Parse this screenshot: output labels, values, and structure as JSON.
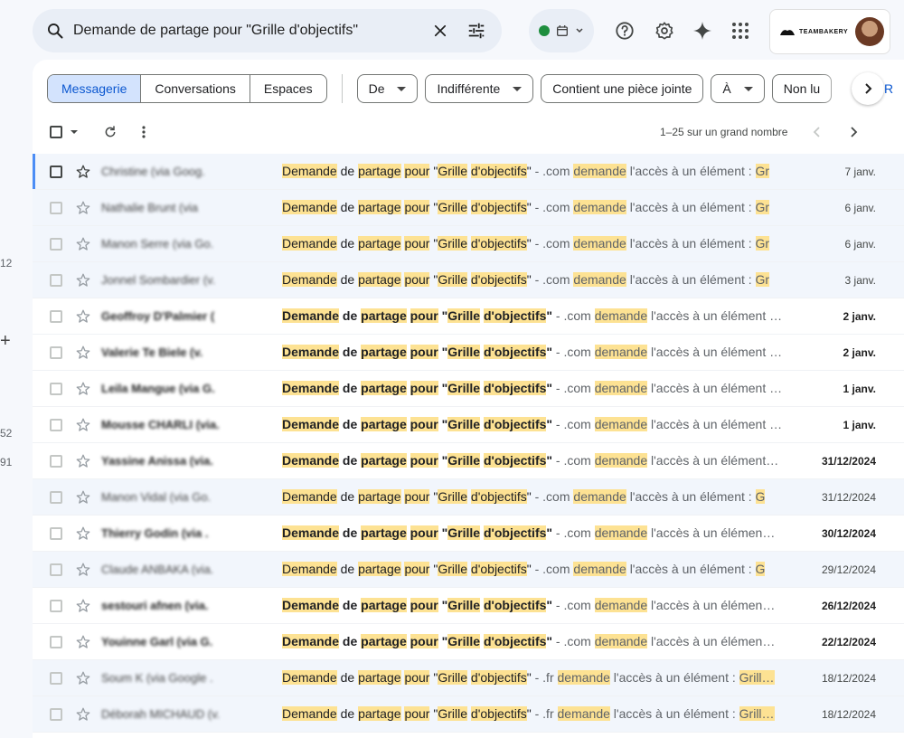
{
  "left_edge": {
    "frag1": "12",
    "frag2": "52",
    "frag3": "91"
  },
  "search": {
    "query": "Demande de partage pour \"Grille d'objectifs\"",
    "icon": "search-icon",
    "clear_icon": "close-icon",
    "options_icon": "tune-icon"
  },
  "top_bar": {
    "status_color": "#1e8e3e",
    "help_icon": "help-icon",
    "settings_icon": "gear-icon",
    "gemini_icon": "sparkle-icon",
    "apps_icon": "apps-grid-icon",
    "account_logo_text": "TEAMBAKERY"
  },
  "filters": {
    "tabs": [
      "Messagerie",
      "Conversations",
      "Espaces"
    ],
    "chips": [
      "De",
      "Indifférente",
      "Contient une pièce jointe",
      "À",
      "Non lu"
    ],
    "trailing_fragment": "R"
  },
  "toolbar": {
    "pager_text": "1–25 sur un grand nombre"
  },
  "messages": [
    {
      "sender": "Christine (via Goog.",
      "state": "selected",
      "domain": ".com",
      "tail": "l'accès à un élément : ",
      "tail_hl": "Gr",
      "date": "7 janv."
    },
    {
      "sender": "Nathalie Brunt (via",
      "state": "read",
      "domain": ".com",
      "tail": "l'accès à un élément : ",
      "tail_hl": "Gr",
      "date": "6 janv."
    },
    {
      "sender": "Manon Serre (via Go.",
      "state": "read",
      "domain": ".com",
      "tail": "l'accès à un élément : ",
      "tail_hl": "Gr",
      "date": "6 janv."
    },
    {
      "sender": "Jonnel Sombardier (v.",
      "state": "read",
      "domain": ".com",
      "tail": "l'accès à un élément : ",
      "tail_hl": "Gr",
      "date": "3 janv."
    },
    {
      "sender": "Geoffroy D'Palmier (",
      "state": "unread",
      "domain": ".com",
      "tail": "l'accès à un élément …",
      "tail_hl": "",
      "date": "2 janv."
    },
    {
      "sender": "Valerie Te Biele (v.",
      "state": "unread",
      "domain": ".com",
      "tail": "l'accès à un élément …",
      "tail_hl": "",
      "date": "2 janv."
    },
    {
      "sender": "Leila Mangue (via G.",
      "state": "unread",
      "domain": ".com",
      "tail": "l'accès à un élément …",
      "tail_hl": "",
      "date": "1 janv."
    },
    {
      "sender": "Mousse CHARLI (via.",
      "state": "unread",
      "domain": ".com",
      "tail": "l'accès à un élément …",
      "tail_hl": "",
      "date": "1 janv."
    },
    {
      "sender": "Yassine Anissa (via.",
      "state": "unread",
      "domain": ".com",
      "tail": "l'accès à un élément…",
      "tail_hl": "",
      "date": "31/12/2024"
    },
    {
      "sender": "Manon Vidal (via Go.",
      "state": "read",
      "domain": ".com",
      "tail": "l'accès à un élément : ",
      "tail_hl": "G",
      "date": "31/12/2024"
    },
    {
      "sender": "Thierry Godin (via .",
      "state": "unread",
      "domain": ".com",
      "tail": "l'accès à un élémen…",
      "tail_hl": "",
      "date": "30/12/2024"
    },
    {
      "sender": "Claude ANBAKA (via.",
      "state": "read",
      "domain": ".com",
      "tail": "l'accès à un élément : ",
      "tail_hl": "G",
      "date": "29/12/2024"
    },
    {
      "sender": "sestouri afnen (via.",
      "state": "unread",
      "domain": ".com",
      "tail": "l'accès à un élémen…",
      "tail_hl": "",
      "date": "26/12/2024"
    },
    {
      "sender": "Youinne Garl (via G.",
      "state": "unread",
      "domain": ".com",
      "tail": "l'accès à un élémen…",
      "tail_hl": "",
      "date": "22/12/2024"
    },
    {
      "sender": "Soum K (via Google .",
      "state": "read",
      "domain": ".fr",
      "tail": "l'accès à un élément : ",
      "tail_hl": "Grill…",
      "date": "18/12/2024"
    },
    {
      "sender": "Déborah MICHAUD (v.",
      "state": "read",
      "domain": ".fr",
      "tail": "l'accès à un élément : ",
      "tail_hl": "Grill…",
      "date": "18/12/2024"
    }
  ],
  "subject_parts": {
    "w1": "Demande",
    "w2": "de",
    "w3": "partage",
    "w4": "pour",
    "q1": "\"",
    "w5": "Grille",
    "w6": "d'objectifs",
    "q2": "\"",
    "sep": " - ",
    "w7": "demande"
  }
}
